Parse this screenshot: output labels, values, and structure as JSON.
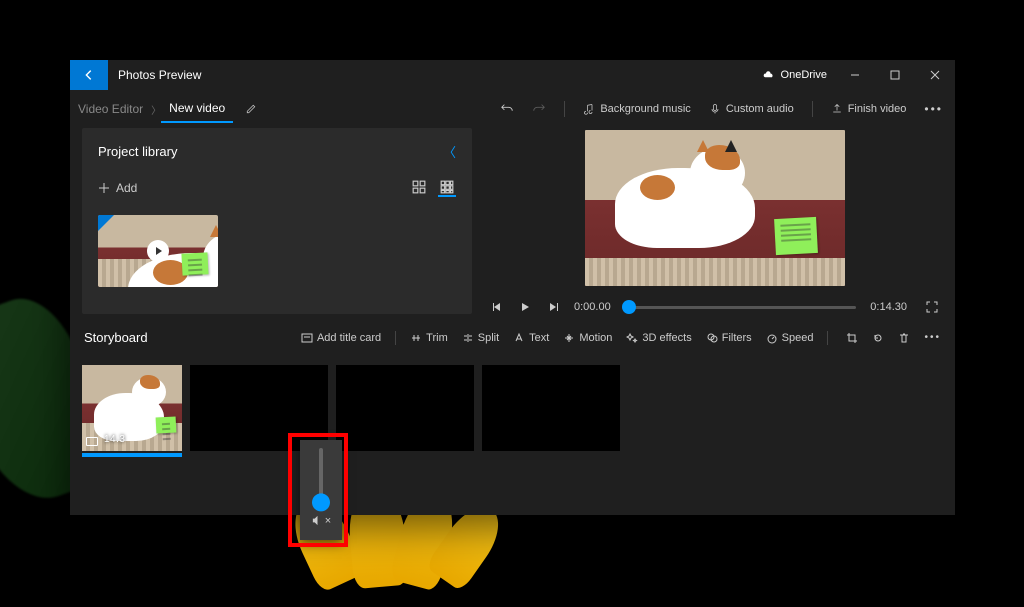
{
  "titlebar": {
    "app_name": "Photos Preview",
    "cloud_label": "OneDrive"
  },
  "breadcrumb": {
    "root": "Video Editor",
    "current": "New video"
  },
  "toolbar": {
    "undo": "Undo",
    "redo": "Redo",
    "bg_music": "Background music",
    "custom_audio": "Custom audio",
    "finish": "Finish video"
  },
  "library": {
    "title": "Project library",
    "add_label": "Add"
  },
  "player": {
    "current_time": "0:00.00",
    "total_time": "0:14.30"
  },
  "storyboard": {
    "title": "Storyboard",
    "add_title_card": "Add title card",
    "trim": "Trim",
    "split": "Split",
    "text": "Text",
    "motion": "Motion",
    "effects": "3D effects",
    "filters": "Filters",
    "speed": "Speed",
    "clip1_duration": "14.3"
  }
}
